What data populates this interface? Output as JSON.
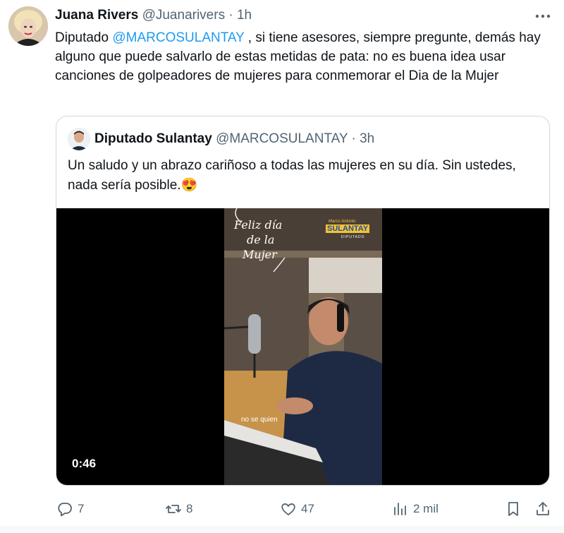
{
  "tweet": {
    "author_name": "Juana Rivers",
    "author_handle": "@Juanarivers",
    "time": " · 1h",
    "text_prefix": "Diputado ",
    "mention": "@MARCOSULANTAY",
    "text_rest": " , si tiene asesores, siempre pregunte, demás hay alguno que puede salvarlo de estas metidas de pata: no es buena idea usar canciones de golpeadores de mujeres para conmemorar el Dia de la Mujer"
  },
  "quote": {
    "author_name": "Diputado Sulantay",
    "author_handle": "@MARCOSULANTAY",
    "time": " · 3h",
    "text": "Un saludo y un abrazo cariñoso a todas las mujeres en su día. Sin ustedes, nada sería posible.",
    "emoji": "😍",
    "video": {
      "duration": "0:46",
      "overlay_line1": "Feliz día",
      "overlay_line2": "de la",
      "overlay_line3": "Mujer",
      "logo_small": "Marco Antonio",
      "logo_main": "SULANTAY",
      "logo_sub": "DIPUTADO",
      "subtitle": "no se quien"
    }
  },
  "actions": {
    "replies": "7",
    "reposts": "8",
    "likes": "47",
    "views": "2 mil"
  },
  "colors": {
    "accent": "#1d9bf0",
    "muted": "#536471",
    "text": "#0f1419",
    "border": "#cfd9de"
  }
}
